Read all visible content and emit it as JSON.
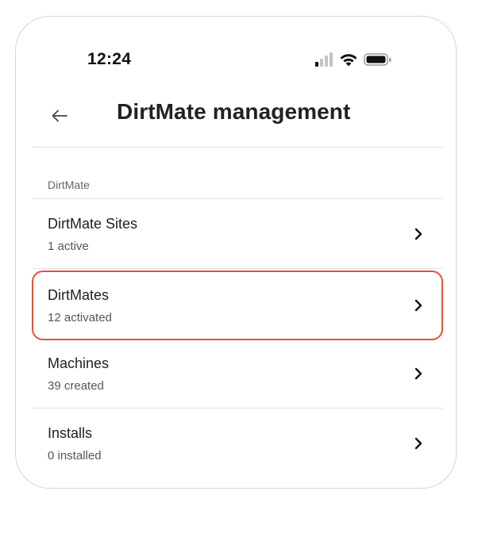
{
  "status_bar": {
    "time": "12:24",
    "icons": [
      "signal-icon",
      "wifi-icon",
      "battery-icon"
    ]
  },
  "header": {
    "back_icon": "arrow-left-icon",
    "title": "DirtMate management"
  },
  "section": {
    "label": "DirtMate"
  },
  "items": [
    {
      "title": "DirtMate Sites",
      "subtitle": "1 active",
      "icon": "chevron-right-icon"
    },
    {
      "title": "DirtMates",
      "subtitle": "12 activated",
      "icon": "chevron-right-icon",
      "highlighted": true
    },
    {
      "title": "Machines",
      "subtitle": "39 created",
      "icon": "chevron-right-icon"
    },
    {
      "title": "Installs",
      "subtitle": "0 installed",
      "icon": "chevron-right-icon"
    }
  ],
  "colors": {
    "highlight_border": "#e0553a",
    "divider": "#e2e2e2",
    "text_primary": "#1f1f1f",
    "text_secondary": "#555555"
  }
}
